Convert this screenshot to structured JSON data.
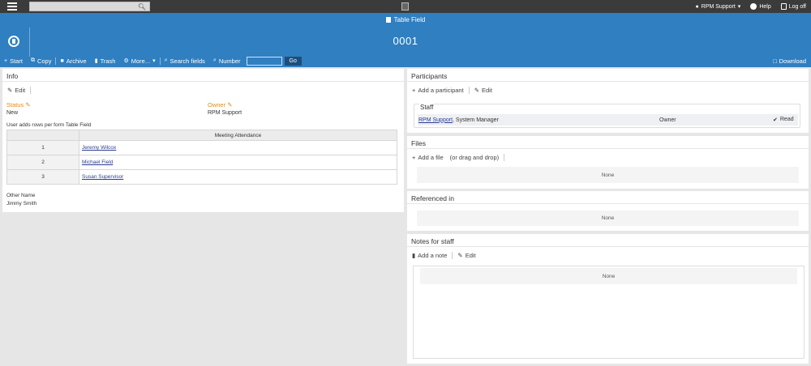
{
  "topbar": {
    "menu_icon": "hamburger-icon",
    "search_placeholder": "",
    "user_label": "RPM Support",
    "help_label": "Help",
    "logoff_label": "Log off"
  },
  "header": {
    "form_type": "Table Field",
    "record_number": "0001"
  },
  "toolbar": {
    "start": "Start",
    "copy": "Copy",
    "archive": "Archive",
    "trash": "Trash",
    "more": "More...",
    "search_fields": "Search fields",
    "number": "Number",
    "number_value": "",
    "go": "Go",
    "download": "Download"
  },
  "info": {
    "title": "Info",
    "edit": "Edit",
    "status_label": "Status",
    "status_value": "New",
    "owner_label": "Owner",
    "owner_value": "RPM Support",
    "table_caption": "User adds rows per form Table Field",
    "table_header": "Meeting Attendance",
    "rows": [
      {
        "n": "1",
        "name": "Jeremy Wilcox"
      },
      {
        "n": "2",
        "name": "Michael Field"
      },
      {
        "n": "3",
        "name": "Susan Supervisor"
      }
    ],
    "other_name_label": "Other Name",
    "other_name_value": "Jimmy Smith"
  },
  "participants": {
    "title": "Participants",
    "add": "Add a participant",
    "edit": "Edit",
    "staff_legend": "Staff",
    "staff_name": "RPM Support",
    "staff_role_suffix": ", System Manager",
    "staff_type": "Owner",
    "staff_access": "Read"
  },
  "files": {
    "title": "Files",
    "add": "Add a file",
    "drag": "(or drag and drop)",
    "none": "None"
  },
  "referenced": {
    "title": "Referenced in",
    "none": "None"
  },
  "notes": {
    "title": "Notes for staff",
    "add": "Add a note",
    "edit": "Edit",
    "none": "None"
  },
  "colors": {
    "header_blue": "#2f7fc1",
    "topbar": "#3b3b3b",
    "label_orange": "#e88b15"
  }
}
